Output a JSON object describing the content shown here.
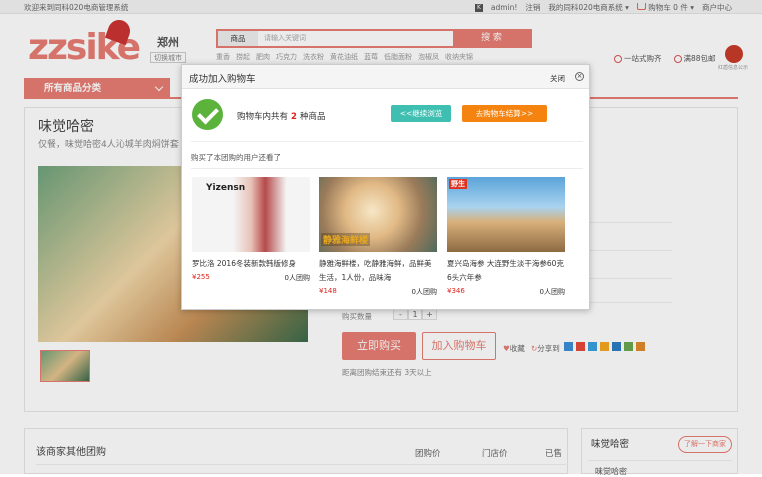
{
  "topbar": {
    "welcome": "欢迎来到同科020电商管理系统",
    "user": "admin!",
    "logout": "注销",
    "my_account": "我的同科020电商系统",
    "cart": "购物车 0 件",
    "merchant_center": "商户中心"
  },
  "header": {
    "logo": "zzsike",
    "city": "郑州",
    "switch_city": "切换城市",
    "search": {
      "category": "商品",
      "placeholder": "请输入关键词",
      "button": "搜 索"
    },
    "hot_words": [
      "重香",
      "捞起",
      "肥肉",
      "巧克力",
      "洗衣粉",
      "黄花油纸",
      "蓝莓",
      "低脂面粉",
      "泡椒凤",
      "收纳夹锦"
    ],
    "services": [
      "一站式购齐",
      "满88包邮"
    ],
    "badge_caption": "红盾信息公示"
  },
  "nav": {
    "all_categories": "所有商品分类"
  },
  "product": {
    "title": "味觉哈密",
    "subtitle": "仅餐，味觉哈密4人沁城羊肉焖饼套",
    "qty_label": "购买数量",
    "qty_value": "1",
    "qty_minus": "-",
    "qty_plus": "+",
    "buy_now": "立即购买",
    "add_to_cart": "加入购物车",
    "favorite": "收藏",
    "share_to": "分享到",
    "countdown": "距离团购结束还有 3天以上"
  },
  "others": {
    "title": "该商家其他团购",
    "columns": [
      "团购价",
      "门店价",
      "已售"
    ]
  },
  "sidebar": {
    "title": "味觉哈密",
    "button": "了解一下商家",
    "sub": "味觉哈密"
  },
  "modal": {
    "title": "成功加入购物车",
    "close": "关闭",
    "cart_msg_prefix": "购物车内共有",
    "cart_count": "2",
    "cart_msg_suffix": "种商品",
    "continue_btn": "<<继续浏览",
    "checkout_btn": "去购物车结算>>",
    "also_bought": "购买了本团购的用户还看了",
    "products": [
      {
        "name": "罗比洛 2016冬装新款韩版修身",
        "price": "¥255",
        "sold": "0人团购",
        "img_text": "Yizensn"
      },
      {
        "name": "静雅海鲜楼，吃静雅海鲜，品鲜美生活，1人份，品味海",
        "price": "¥148",
        "sold": "0人团购",
        "img_text": "静雅海鲜楼"
      },
      {
        "name": "夏兴岛海参 大连野生淡干海参60克6头六年参",
        "price": "¥346",
        "sold": "0人团购",
        "img_text": "野生"
      }
    ]
  }
}
